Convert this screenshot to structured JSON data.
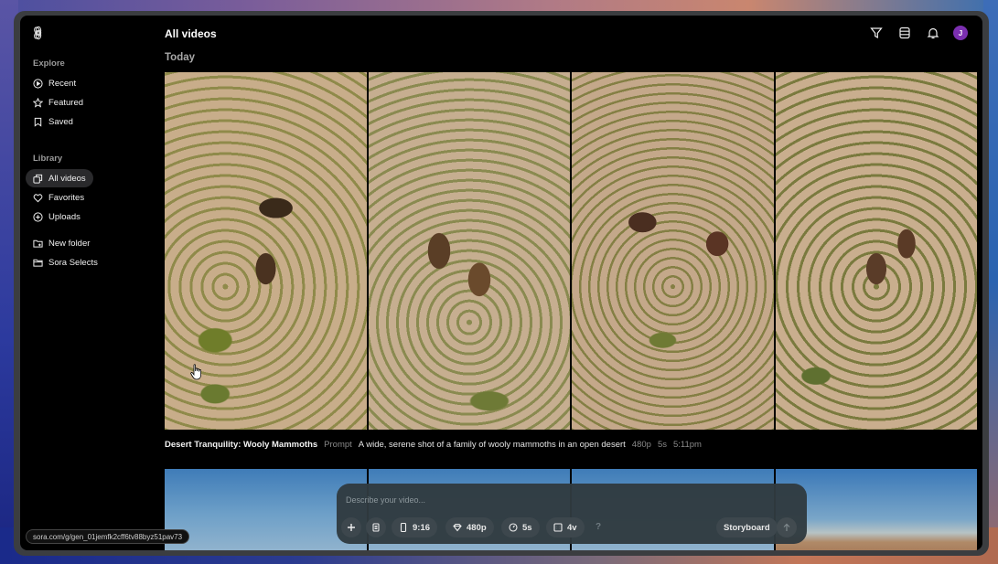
{
  "window": {
    "title": "All videos",
    "section": "Today"
  },
  "sidebar": {
    "explore_label": "Explore",
    "explore_items": [
      {
        "label": "Recent",
        "icon": "play-circle-icon"
      },
      {
        "label": "Featured",
        "icon": "star-icon"
      },
      {
        "label": "Saved",
        "icon": "bookmark-icon"
      }
    ],
    "library_label": "Library",
    "library_items": [
      {
        "label": "All videos",
        "icon": "videos-icon",
        "active": true
      },
      {
        "label": "Favorites",
        "icon": "heart-icon"
      },
      {
        "label": "Uploads",
        "icon": "plus-circle-icon"
      }
    ],
    "folders": [
      {
        "label": "New folder",
        "icon": "folder-plus-icon"
      },
      {
        "label": "Sora Selects",
        "icon": "folder-icon"
      }
    ]
  },
  "header": {
    "icons": [
      "filter-icon",
      "list-view-icon",
      "bell-icon"
    ],
    "avatar_initial": "J",
    "avatar_color": "#7b2fb0"
  },
  "video_group": {
    "title": "Desert Tranquility: Wooly Mammoths",
    "prompt_label": "Prompt",
    "prompt": "A wide, serene shot of a family of wooly mammoths in an open desert",
    "resolution": "480p",
    "duration": "5s",
    "time": "5:11pm",
    "thumbnails": [
      "Mammoths aerial 1",
      "Mammoths aerial 2",
      "Mammoths aerial 3",
      "Mammoths aerial 4"
    ]
  },
  "composer": {
    "placeholder": "Describe your video...",
    "value": "",
    "aspect_ratio": "9:16",
    "resolution": "480p",
    "duration": "5s",
    "variations": "4v",
    "help": "?",
    "storyboard_label": "Storyboard"
  },
  "status_url": "sora.com/g/gen_01jemfk2cff6tv88byz51pav73"
}
